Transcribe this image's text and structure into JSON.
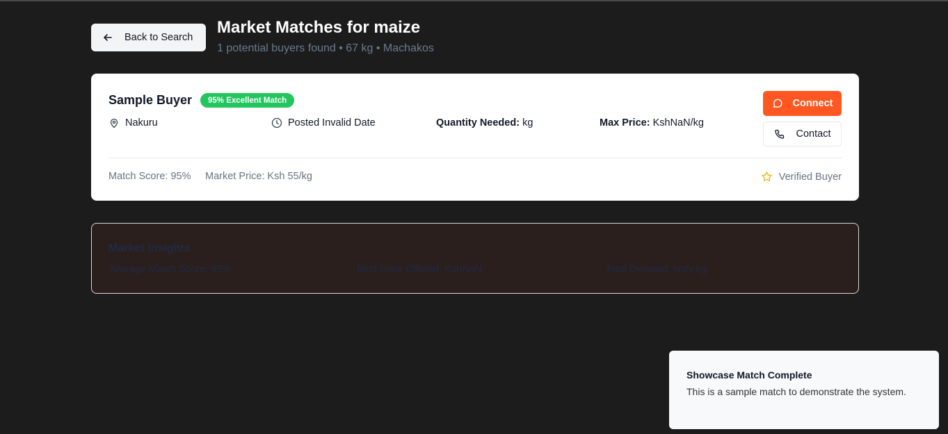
{
  "header": {
    "back_label": "Back to Search",
    "title": "Market Matches for maize",
    "subtitle": "1 potential buyers found • 67 kg • Machakos"
  },
  "buyer_card": {
    "name": "Sample Buyer",
    "badge": "95% Excellent Match",
    "location": "Nakuru",
    "posted": "Posted Invalid Date",
    "quantity_label": "Quantity Needed:",
    "quantity_value": "kg",
    "max_price_label": "Max Price:",
    "max_price_value": "KshNaN/kg",
    "connect_label": "Connect",
    "contact_label": "Contact",
    "match_score": "Match Score: 95%",
    "market_price": "Market Price: Ksh 55/kg",
    "verified": "Verified Buyer"
  },
  "insights": {
    "title": "Market Insights",
    "avg_score": "Average Match Score: 95%",
    "best_price": "Best Price Offered: KshNaN",
    "total_demand": "Total Demand: NaN kg"
  },
  "toast": {
    "title": "Showcase Match Complete",
    "body": "This is a sample match to demonstrate the system."
  },
  "colors": {
    "background": "#1c1c1c",
    "accent": "#ff5722",
    "badge": "#22c55e",
    "star": "#eab308"
  }
}
